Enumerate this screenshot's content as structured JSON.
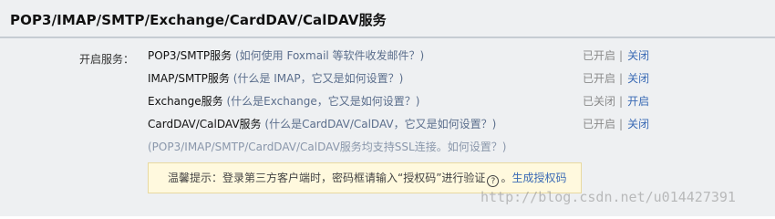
{
  "header": {
    "title": "POP3/IMAP/SMTP/Exchange/CardDAV/CalDAV服务"
  },
  "services_label": "开启服务：",
  "services": [
    {
      "name": "POP3/SMTP服务",
      "help_open": "(",
      "help": "如何使用 Foxmail 等软件收发邮件？",
      "help_close": ")",
      "state": "已开启",
      "sep": "|",
      "action": "关闭"
    },
    {
      "name": "IMAP/SMTP服务",
      "help_open": "(",
      "help": "什么是 IMAP，它又是如何设置？",
      "help_close": ")",
      "state": "已开启",
      "sep": "|",
      "action": "关闭"
    },
    {
      "name": "Exchange服务",
      "help_open": "(",
      "help": "什么是Exchange，它又是如何设置？",
      "help_close": ")",
      "state": "已关闭",
      "sep": "|",
      "action": "开启"
    },
    {
      "name": "CardDAV/CalDAV服务",
      "help_open": "(",
      "help": "什么是CardDAV/CalDAV，它又是如何设置？",
      "help_close": ")",
      "state": "已开启",
      "sep": "|",
      "action": "关闭"
    }
  ],
  "ssl_note": {
    "text": "(POP3/IMAP/SMTP/CardDAV/CalDAV服务均支持SSL连接。",
    "link": "如何设置？",
    "close": ")"
  },
  "tip": {
    "text": "温馨提示：登录第三方客户端时，密码框请输入“授权码”进行验证",
    "help_glyph": "?",
    "link": "生成授权码"
  },
  "watermark": "http://blog.csdn.net/u014427391"
}
